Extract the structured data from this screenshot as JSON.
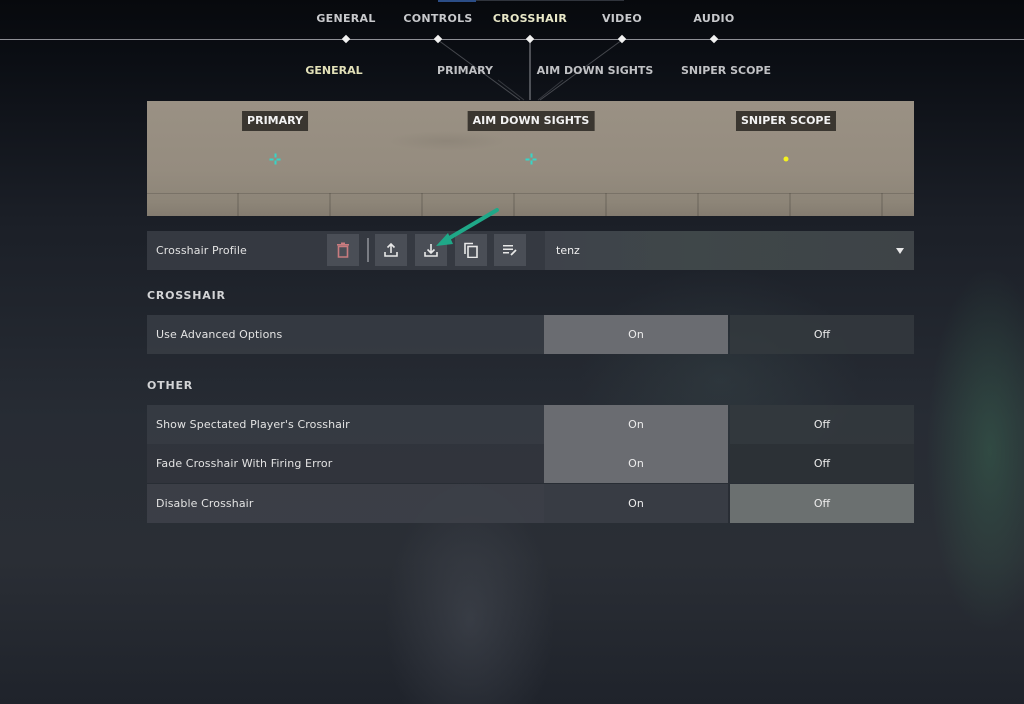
{
  "top_nav": {
    "tabs": [
      {
        "label": "GENERAL",
        "active": false
      },
      {
        "label": "CONTROLS",
        "active": false
      },
      {
        "label": "CROSSHAIR",
        "active": true
      },
      {
        "label": "VIDEO",
        "active": false
      },
      {
        "label": "AUDIO",
        "active": false
      }
    ]
  },
  "sub_nav": {
    "tabs": [
      {
        "label": "GENERAL",
        "active": true
      },
      {
        "label": "PRIMARY",
        "active": false
      },
      {
        "label": "AIM DOWN SIGHTS",
        "active": false
      },
      {
        "label": "SNIPER SCOPE",
        "active": false
      }
    ]
  },
  "preview": {
    "labels": [
      "PRIMARY",
      "AIM DOWN SIGHTS",
      "SNIPER SCOPE"
    ],
    "crosshair_color": "#35d6c8",
    "sniper_dot_color": "#f4f21e"
  },
  "profile": {
    "label": "Crosshair Profile",
    "selected": "tenz",
    "buttons": [
      {
        "icon": "trash-icon",
        "label": "Delete"
      },
      {
        "icon": "upload-icon",
        "label": "Export"
      },
      {
        "icon": "download-icon",
        "label": "Import"
      },
      {
        "icon": "copy-icon",
        "label": "Duplicate"
      },
      {
        "icon": "rename-icon",
        "label": "Rename"
      }
    ]
  },
  "annotation": {
    "arrow_color": "#1fa888",
    "points_to": "download-icon"
  },
  "sections": [
    {
      "title": "CROSSHAIR",
      "settings": [
        {
          "label": "Use Advanced Options",
          "on_label": "On",
          "off_label": "Off",
          "value": "On"
        }
      ]
    },
    {
      "title": "OTHER",
      "settings": [
        {
          "label": "Show Spectated Player's Crosshair",
          "on_label": "On",
          "off_label": "Off",
          "value": "On"
        },
        {
          "label": "Fade Crosshair With Firing Error",
          "on_label": "On",
          "off_label": "Off",
          "value": "On"
        },
        {
          "label": "Disable Crosshair",
          "on_label": "On",
          "off_label": "Off",
          "value": "Off"
        }
      ]
    }
  ]
}
